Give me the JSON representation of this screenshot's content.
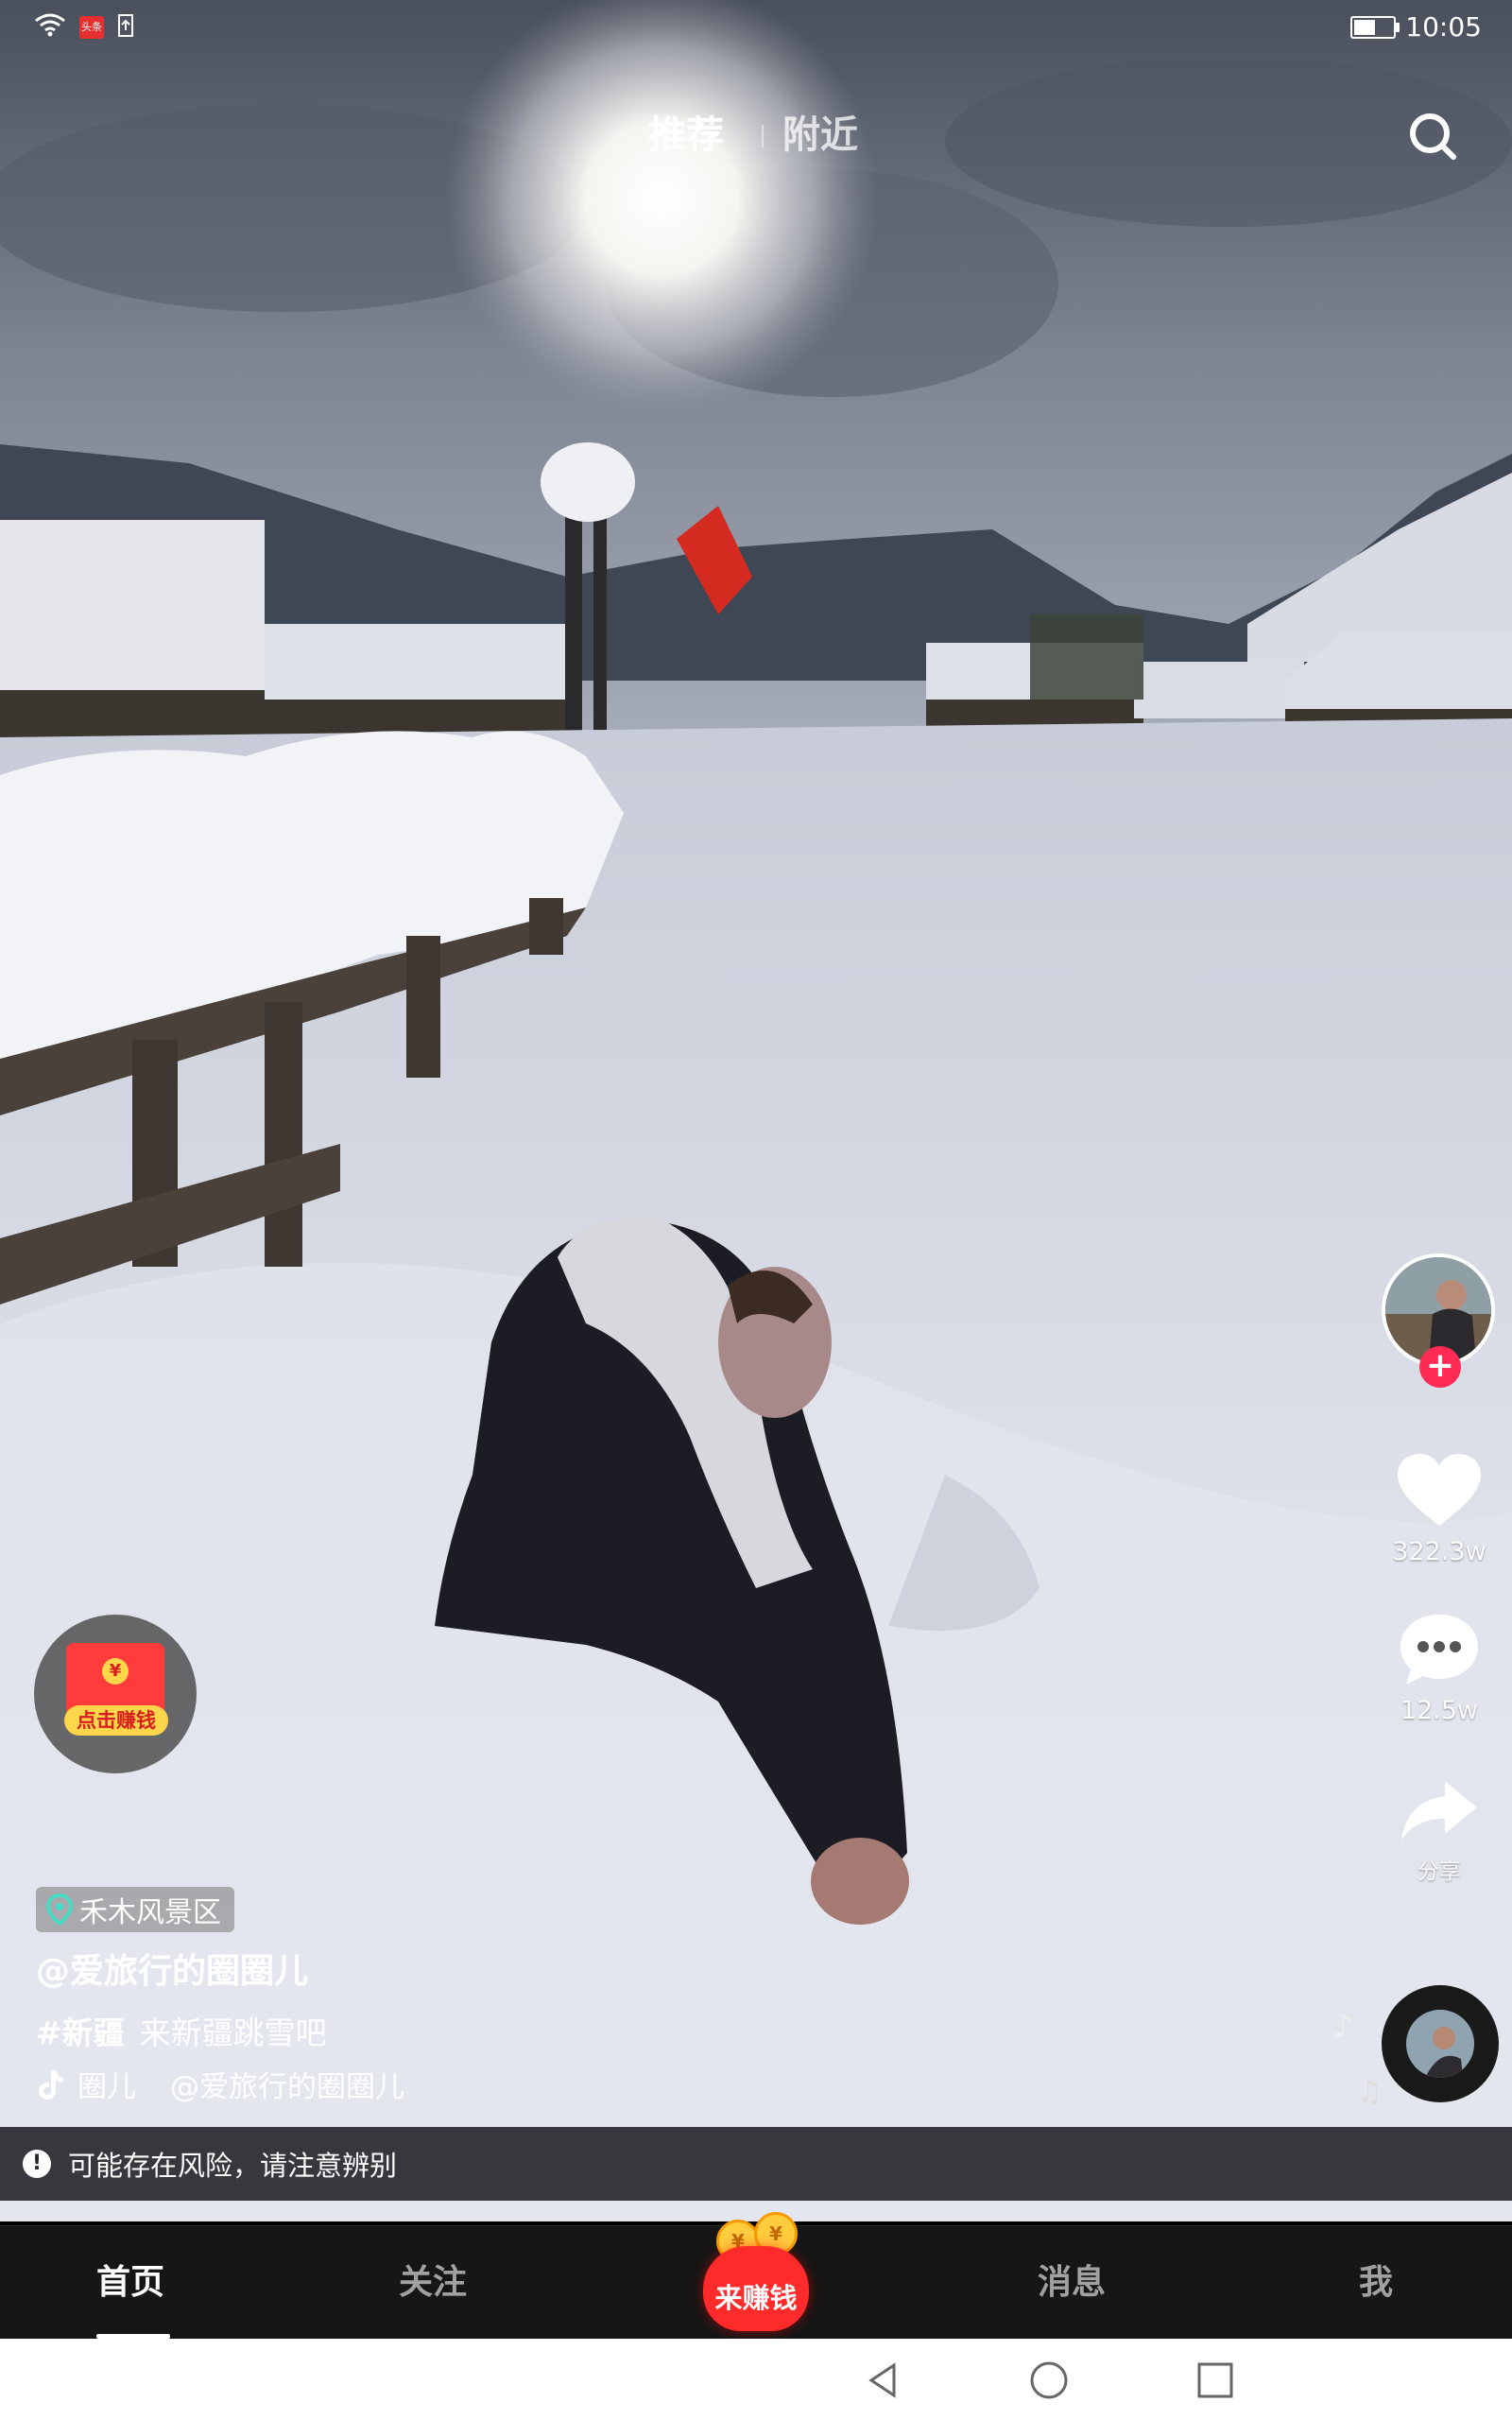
{
  "status_bar": {
    "time": "10:05",
    "app_badge": "头条",
    "battery_level": 0.55,
    "icons": [
      "wifi-icon",
      "app-badge-icon",
      "upload-icon",
      "battery-icon"
    ]
  },
  "top_tabs": {
    "recommended": "推荐",
    "nearby": "附近",
    "active": "推荐"
  },
  "side_actions": {
    "likes": "322.3w",
    "comments": "12.5w",
    "share": "分享"
  },
  "red_packet": {
    "coin": "¥",
    "label": "点击赚钱"
  },
  "caption": {
    "location": "禾木风景区",
    "author": "@爱旅行的圈圈儿",
    "hashtag": "#新疆",
    "text": "来新疆跳雪吧",
    "music_title": "圈儿",
    "music_author": "@爱旅行的圈圈儿"
  },
  "risk_notice": {
    "text": "可能存在风险，请注意辨别"
  },
  "bottom_nav": {
    "home": "首页",
    "follow": "关注",
    "earn": "来赚钱",
    "earn_coin": "¥",
    "messages": "消息",
    "me": "我",
    "active": "首页"
  },
  "colors": {
    "accent_red": "#ff2b55",
    "packet_red": "#ff3b3b",
    "gold": "#ffd54a",
    "nav_bg": "#161616"
  }
}
